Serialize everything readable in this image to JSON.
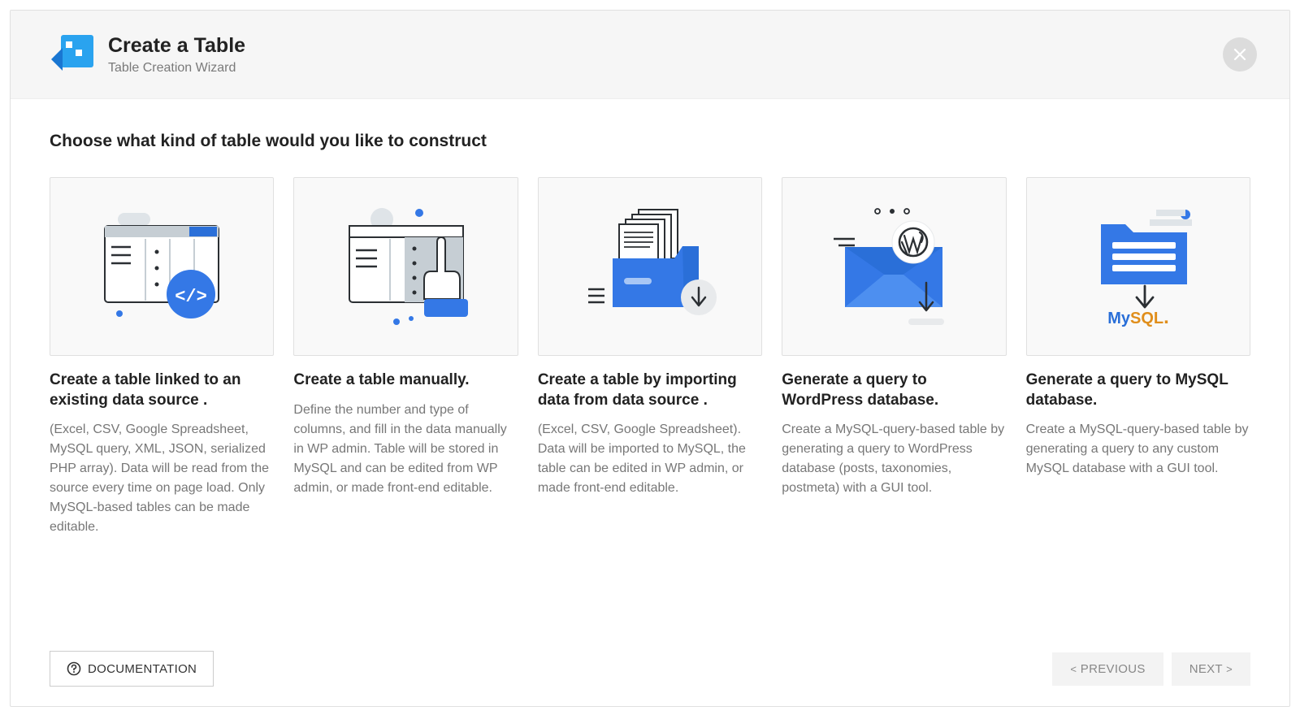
{
  "header": {
    "title": "Create a Table",
    "subtitle": "Table Creation Wizard"
  },
  "content": {
    "heading": "Choose what kind of table would you like to construct"
  },
  "cards": [
    {
      "title": "Create a table linked to an existing data source .",
      "desc": "(Excel, CSV, Google Spreadsheet, MySQL query, XML, JSON, serialized PHP array). Data will be read from the source every time on page load. Only MySQL-based tables can be made editable."
    },
    {
      "title": "Create a table manually.",
      "desc": "Define the number and type of columns, and fill in the data manually in WP admin. Table will be stored in MySQL and can be edited from WP admin, or made front-end editable."
    },
    {
      "title": "Create a table by importing data from data source .",
      "desc": "(Excel, CSV, Google Spreadsheet). Data will be imported to MySQL, the table can be edited in WP admin, or made front-end editable."
    },
    {
      "title": "Generate a query to WordPress database.",
      "desc": "Create a MySQL-query-based table by generating a query to WordPress database (posts, taxonomies, postmeta) with a GUI tool."
    },
    {
      "title": "Generate a query to MySQL database.",
      "desc": "Create a MySQL-query-based table by generating a query to any custom MySQL database with a GUI tool."
    }
  ],
  "footer": {
    "documentation": "DOCUMENTATION",
    "previous": "PREVIOUS",
    "next": "NEXT"
  }
}
